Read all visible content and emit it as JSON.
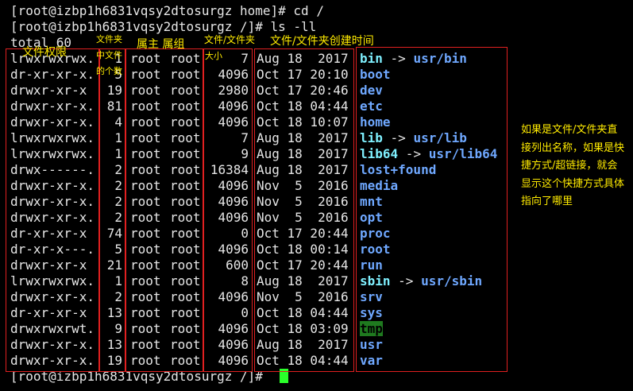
{
  "terminal": {
    "prompt1": "[root@izbp1h6831vqsy2dtosurgz home]# cd /",
    "prompt2": "[root@izbp1h6831vqsy2dtosurgz /]# ls -ll",
    "total": "total 60",
    "prompt_last": "[root@izbp1h6831vqsy2dtosurgz /]# "
  },
  "listing": [
    {
      "perm": "lrwxrwxrwx.",
      "links": "1",
      "owner": "root",
      "group": "root",
      "size": "7",
      "date": "Aug 18  2017",
      "name": "bin",
      "kind": "link",
      "target": "usr/bin"
    },
    {
      "perm": "dr-xr-xr-x.",
      "links": "5",
      "owner": "root",
      "group": "root",
      "size": "4096",
      "date": "Oct 17 20:10",
      "name": "boot",
      "kind": "dir",
      "target": ""
    },
    {
      "perm": "drwxr-xr-x",
      "links": "19",
      "owner": "root",
      "group": "root",
      "size": "2980",
      "date": "Oct 17 20:46",
      "name": "dev",
      "kind": "dir",
      "target": ""
    },
    {
      "perm": "drwxr-xr-x.",
      "links": "81",
      "owner": "root",
      "group": "root",
      "size": "4096",
      "date": "Oct 18 04:44",
      "name": "etc",
      "kind": "dir",
      "target": ""
    },
    {
      "perm": "drwxr-xr-x.",
      "links": "4",
      "owner": "root",
      "group": "root",
      "size": "4096",
      "date": "Oct 18 10:07",
      "name": "home",
      "kind": "dir",
      "target": ""
    },
    {
      "perm": "lrwxrwxrwx.",
      "links": "1",
      "owner": "root",
      "group": "root",
      "size": "7",
      "date": "Aug 18  2017",
      "name": "lib",
      "kind": "link",
      "target": "usr/lib"
    },
    {
      "perm": "lrwxrwxrwx.",
      "links": "1",
      "owner": "root",
      "group": "root",
      "size": "9",
      "date": "Aug 18  2017",
      "name": "lib64",
      "kind": "link",
      "target": "usr/lib64"
    },
    {
      "perm": "drwx------.",
      "links": "2",
      "owner": "root",
      "group": "root",
      "size": "16384",
      "date": "Aug 18  2017",
      "name": "lost+found",
      "kind": "dir",
      "target": ""
    },
    {
      "perm": "drwxr-xr-x.",
      "links": "2",
      "owner": "root",
      "group": "root",
      "size": "4096",
      "date": "Nov  5  2016",
      "name": "media",
      "kind": "dir",
      "target": ""
    },
    {
      "perm": "drwxr-xr-x.",
      "links": "2",
      "owner": "root",
      "group": "root",
      "size": "4096",
      "date": "Nov  5  2016",
      "name": "mnt",
      "kind": "dir",
      "target": ""
    },
    {
      "perm": "drwxr-xr-x.",
      "links": "2",
      "owner": "root",
      "group": "root",
      "size": "4096",
      "date": "Nov  5  2016",
      "name": "opt",
      "kind": "dir",
      "target": ""
    },
    {
      "perm": "dr-xr-xr-x",
      "links": "74",
      "owner": "root",
      "group": "root",
      "size": "0",
      "date": "Oct 17 20:44",
      "name": "proc",
      "kind": "dir",
      "target": ""
    },
    {
      "perm": "dr-xr-x---.",
      "links": "5",
      "owner": "root",
      "group": "root",
      "size": "4096",
      "date": "Oct 18 00:14",
      "name": "root",
      "kind": "dir",
      "target": ""
    },
    {
      "perm": "drwxr-xr-x",
      "links": "21",
      "owner": "root",
      "group": "root",
      "size": "600",
      "date": "Oct 17 20:44",
      "name": "run",
      "kind": "dir",
      "target": ""
    },
    {
      "perm": "lrwxrwxrwx.",
      "links": "1",
      "owner": "root",
      "group": "root",
      "size": "8",
      "date": "Aug 18  2017",
      "name": "sbin",
      "kind": "link",
      "target": "usr/sbin"
    },
    {
      "perm": "drwxr-xr-x.",
      "links": "2",
      "owner": "root",
      "group": "root",
      "size": "4096",
      "date": "Nov  5  2016",
      "name": "srv",
      "kind": "dir",
      "target": ""
    },
    {
      "perm": "dr-xr-xr-x",
      "links": "13",
      "owner": "root",
      "group": "root",
      "size": "0",
      "date": "Oct 18 04:44",
      "name": "sys",
      "kind": "dir",
      "target": ""
    },
    {
      "perm": "drwxrwxrwt.",
      "links": "9",
      "owner": "root",
      "group": "root",
      "size": "4096",
      "date": "Oct 18 03:09",
      "name": "tmp",
      "kind": "tmp",
      "target": ""
    },
    {
      "perm": "drwxr-xr-x.",
      "links": "13",
      "owner": "root",
      "group": "root",
      "size": "4096",
      "date": "Aug 18  2017",
      "name": "usr",
      "kind": "dir",
      "target": ""
    },
    {
      "perm": "drwxr-xr-x.",
      "links": "19",
      "owner": "root",
      "group": "root",
      "size": "4096",
      "date": "Oct 18 04:44",
      "name": "var",
      "kind": "dir",
      "target": ""
    }
  ],
  "annotations": {
    "perm": "文件权限",
    "count_line1": "文件夹",
    "count_line2": "中文件",
    "count_line3": "的个数",
    "owner_group": "属主 属组",
    "size_line1": "文件/文件夹",
    "size_line2": "大小",
    "date": "文件/文件夹创建时间",
    "note": "如果是文件/文件夹直接列出名称，如果是快捷方式/超链接，就会显示这个快捷方式具体指向了哪里"
  },
  "colors": {
    "background": "#000000",
    "text": "#e6e6e6",
    "directory": "#6fa8ff",
    "symlink": "#7ff0ff",
    "tmp_highlight": "#1f7a1f",
    "cursor": "#2aff2a",
    "annotation_box": "#e02020",
    "annotation_text": "#ffeb00"
  }
}
